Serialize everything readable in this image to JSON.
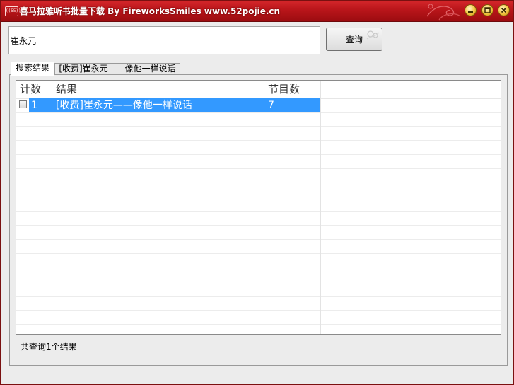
{
  "window": {
    "title": "喜马拉雅听书批量下载 By FireworksSmiles www.52pojie.cn",
    "icon_text": "((55))",
    "accent_color": "#c0181c"
  },
  "search": {
    "value": "崔永元",
    "query_label": "查询"
  },
  "tabs": [
    {
      "label": "搜索结果"
    },
    {
      "label": "[收费]崔永元——像他一样说话"
    }
  ],
  "table": {
    "columns": [
      "计数",
      "结果",
      "节目数"
    ],
    "rows": [
      {
        "count": "1",
        "result": "[收费]崔永元——像他一样说话",
        "episodes": "7"
      }
    ]
  },
  "status": {
    "text": "共查询1个结果"
  }
}
